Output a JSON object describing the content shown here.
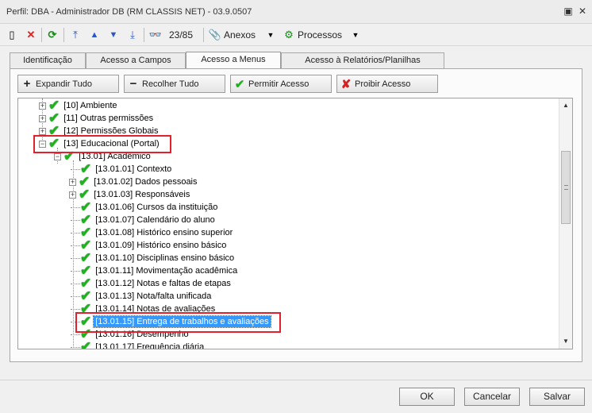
{
  "window": {
    "title": "Perfil: DBA - Administrador DB (RM CLASSIS NET) - 03.9.0507"
  },
  "toolbar": {
    "counter": "23/85",
    "anexos_label": "Anexos",
    "processos_label": "Processos"
  },
  "tabs": [
    {
      "label": "Identificação"
    },
    {
      "label": "Acesso a Campos"
    },
    {
      "label": "Acesso a Menus"
    },
    {
      "label": "Acesso à Relatórios/Planilhas"
    }
  ],
  "actions": {
    "expand": "Expandir Tudo",
    "collapse": "Recolher Tudo",
    "allow": "Permitir Acesso",
    "deny": "Proibir Acesso"
  },
  "tree": {
    "nodes": [
      {
        "label": "[10] Ambiente"
      },
      {
        "label": "[11] Outras permissões"
      },
      {
        "label": "[12] Permissões Globais"
      },
      {
        "label": "[13] Educacional (Portal)"
      },
      {
        "label": "[13.01] Acadêmico"
      },
      {
        "label": "[13.01.01] Contexto"
      },
      {
        "label": "[13.01.02] Dados pessoais"
      },
      {
        "label": "[13.01.03] Responsáveis"
      },
      {
        "label": "[13.01.06] Cursos da instituição"
      },
      {
        "label": "[13.01.07] Calendário do aluno"
      },
      {
        "label": "[13.01.08] Histórico ensino superior"
      },
      {
        "label": "[13.01.09] Histórico ensino básico"
      },
      {
        "label": "[13.01.10] Disciplinas ensino básico"
      },
      {
        "label": "[13.01.11] Movimentação acadêmica"
      },
      {
        "label": "[13.01.12] Notas e faltas de etapas"
      },
      {
        "label": "[13.01.13] Nota/falta unificada"
      },
      {
        "label": "[13.01.14] Notas de avaliações"
      },
      {
        "label": "[13.01.15] Entrega de trabalhos e avaliações"
      },
      {
        "label": "[13.01.16] Desempenho"
      },
      {
        "label": "[13.01.17] Frequência diária"
      }
    ]
  },
  "footer": {
    "ok": "OK",
    "cancel": "Cancelar",
    "save": "Salvar"
  },
  "colors": {
    "check": "#1fb31f",
    "highlight": "#e0212e",
    "selection": "#3399ff"
  }
}
